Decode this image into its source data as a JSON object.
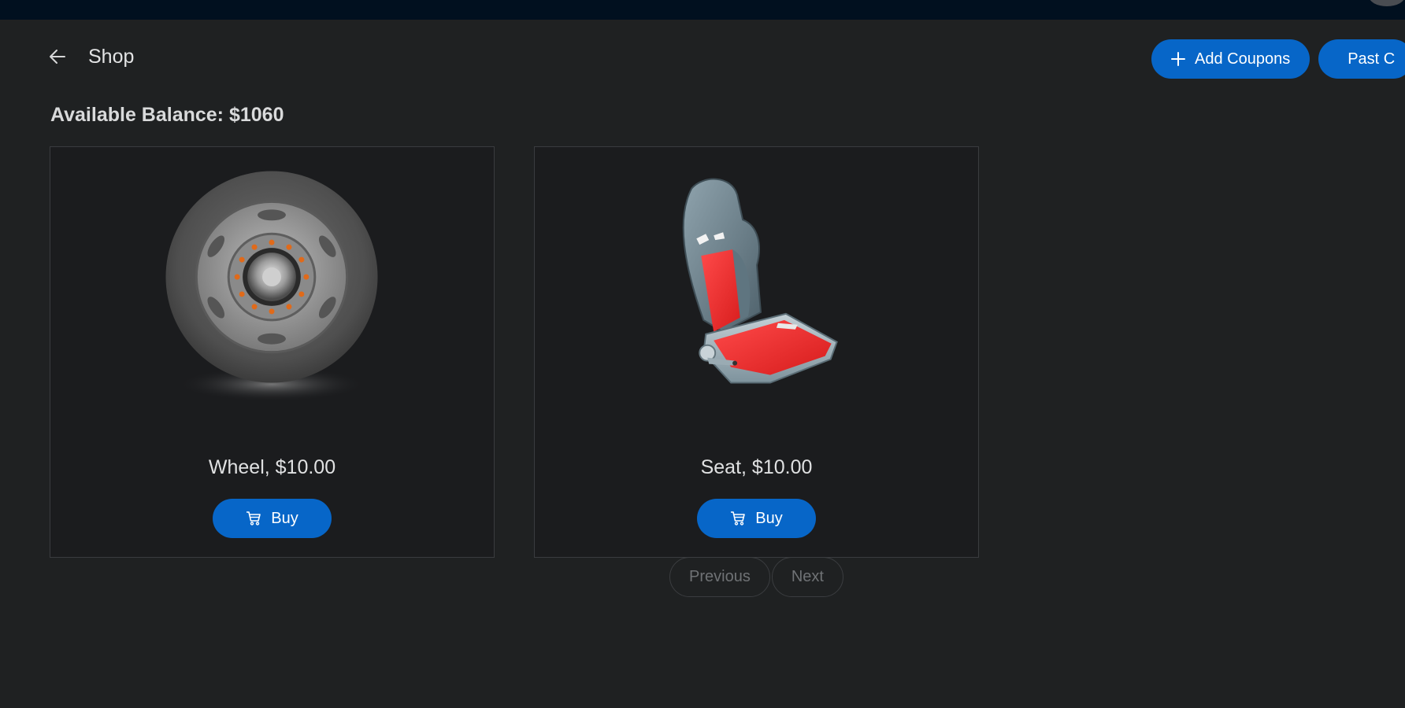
{
  "header": {
    "title": "Shop",
    "back_icon": "arrow-left-icon"
  },
  "actions": {
    "add_coupons_label": "Add Coupons",
    "add_coupons_icon": "plus-icon",
    "past_label": "Past C",
    "past_icon": "list-icon"
  },
  "balance_text": "Available Balance: $1060",
  "products": [
    {
      "label": "Wheel, $10.00",
      "buy_label": "Buy",
      "image": "wheel-image"
    },
    {
      "label": "Seat, $10.00",
      "buy_label": "Buy",
      "image": "seat-image"
    }
  ],
  "pagination": {
    "previous_label": "Previous",
    "next_label": "Next"
  },
  "colors": {
    "background": "#1f2122",
    "topbar": "#01101f",
    "accent": "#0766c8",
    "card": "#1b1c1e"
  }
}
